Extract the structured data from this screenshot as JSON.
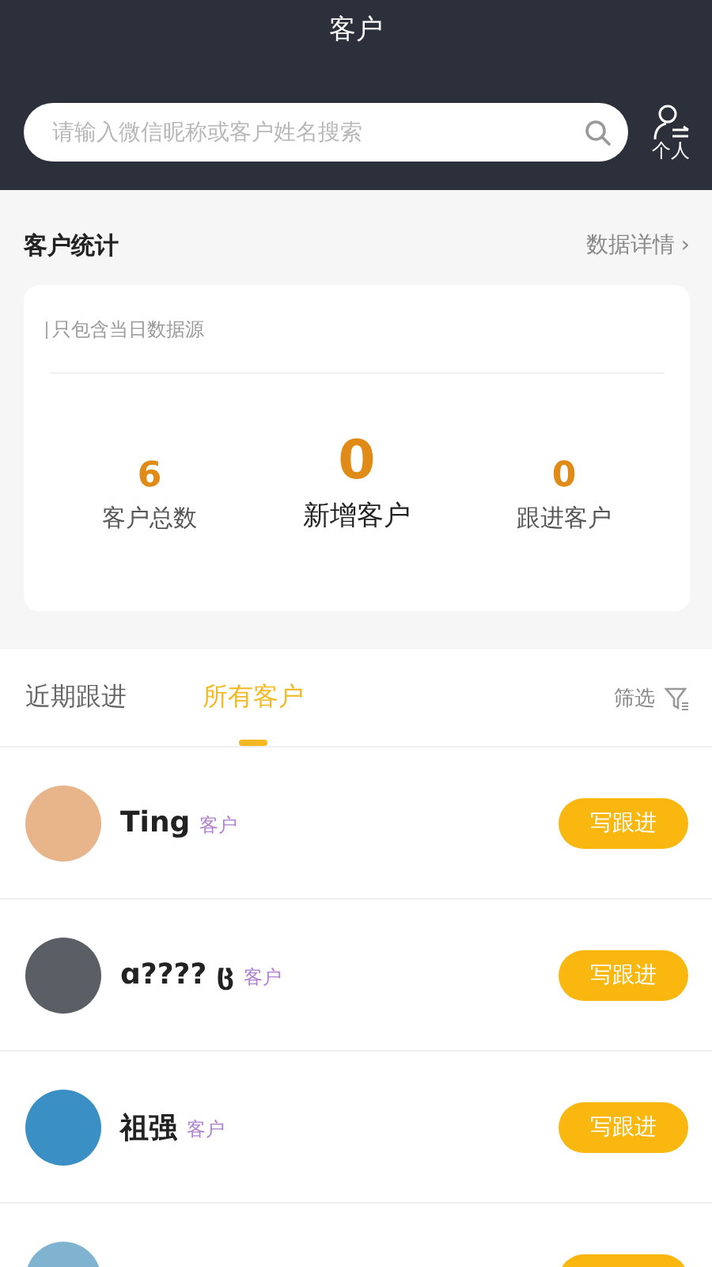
{
  "header": {
    "title": "客户",
    "search": {
      "placeholder": "请输入微信昵称或客户姓名搜索"
    },
    "personal_label": "个人"
  },
  "stats": {
    "title": "客户统计",
    "details_link": "数据详情",
    "chevron": "›",
    "note": "只包含当日数据源",
    "items": [
      {
        "value": "6",
        "label": "客户总数",
        "emphasized": false
      },
      {
        "value": "0",
        "label": "新增客户",
        "emphasized": true
      },
      {
        "value": "0",
        "label": "跟进客户",
        "emphasized": false
      }
    ]
  },
  "tabs": [
    {
      "label": "近期跟进",
      "selected": false
    },
    {
      "label": "所有客户",
      "selected": true
    }
  ],
  "filter_label": "筛选",
  "customers": [
    {
      "kind": "full",
      "name": "Ting",
      "tag": "客户",
      "button": "写跟进",
      "color": "#e8b48a"
    },
    {
      "kind": "full",
      "name": "ɑ???? ც",
      "tag": "客户",
      "button": "写跟进",
      "color": "#5a5f66"
    },
    {
      "kind": "full",
      "name": "祖强",
      "tag": "客户",
      "button": "写跟进",
      "color": "#3a8fc4"
    },
    {
      "kind": "cut",
      "color": "#7fb3d0"
    }
  ]
}
